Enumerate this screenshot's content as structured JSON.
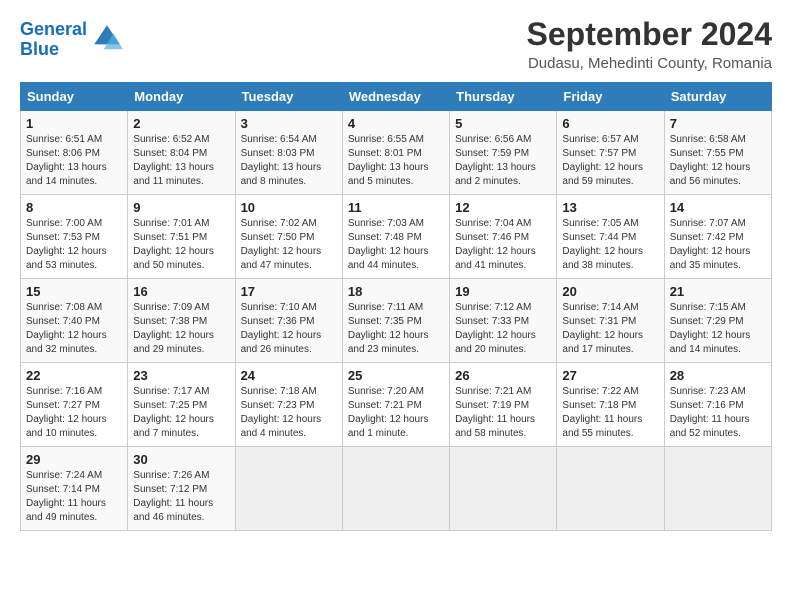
{
  "logo": {
    "line1": "General",
    "line2": "Blue"
  },
  "title": "September 2024",
  "subtitle": "Dudasu, Mehedinti County, Romania",
  "days_of_week": [
    "Sunday",
    "Monday",
    "Tuesday",
    "Wednesday",
    "Thursday",
    "Friday",
    "Saturday"
  ],
  "weeks": [
    [
      {
        "day": "1",
        "info": "Sunrise: 6:51 AM\nSunset: 8:06 PM\nDaylight: 13 hours\nand 14 minutes."
      },
      {
        "day": "2",
        "info": "Sunrise: 6:52 AM\nSunset: 8:04 PM\nDaylight: 13 hours\nand 11 minutes."
      },
      {
        "day": "3",
        "info": "Sunrise: 6:54 AM\nSunset: 8:03 PM\nDaylight: 13 hours\nand 8 minutes."
      },
      {
        "day": "4",
        "info": "Sunrise: 6:55 AM\nSunset: 8:01 PM\nDaylight: 13 hours\nand 5 minutes."
      },
      {
        "day": "5",
        "info": "Sunrise: 6:56 AM\nSunset: 7:59 PM\nDaylight: 13 hours\nand 2 minutes."
      },
      {
        "day": "6",
        "info": "Sunrise: 6:57 AM\nSunset: 7:57 PM\nDaylight: 12 hours\nand 59 minutes."
      },
      {
        "day": "7",
        "info": "Sunrise: 6:58 AM\nSunset: 7:55 PM\nDaylight: 12 hours\nand 56 minutes."
      }
    ],
    [
      {
        "day": "8",
        "info": "Sunrise: 7:00 AM\nSunset: 7:53 PM\nDaylight: 12 hours\nand 53 minutes."
      },
      {
        "day": "9",
        "info": "Sunrise: 7:01 AM\nSunset: 7:51 PM\nDaylight: 12 hours\nand 50 minutes."
      },
      {
        "day": "10",
        "info": "Sunrise: 7:02 AM\nSunset: 7:50 PM\nDaylight: 12 hours\nand 47 minutes."
      },
      {
        "day": "11",
        "info": "Sunrise: 7:03 AM\nSunset: 7:48 PM\nDaylight: 12 hours\nand 44 minutes."
      },
      {
        "day": "12",
        "info": "Sunrise: 7:04 AM\nSunset: 7:46 PM\nDaylight: 12 hours\nand 41 minutes."
      },
      {
        "day": "13",
        "info": "Sunrise: 7:05 AM\nSunset: 7:44 PM\nDaylight: 12 hours\nand 38 minutes."
      },
      {
        "day": "14",
        "info": "Sunrise: 7:07 AM\nSunset: 7:42 PM\nDaylight: 12 hours\nand 35 minutes."
      }
    ],
    [
      {
        "day": "15",
        "info": "Sunrise: 7:08 AM\nSunset: 7:40 PM\nDaylight: 12 hours\nand 32 minutes."
      },
      {
        "day": "16",
        "info": "Sunrise: 7:09 AM\nSunset: 7:38 PM\nDaylight: 12 hours\nand 29 minutes."
      },
      {
        "day": "17",
        "info": "Sunrise: 7:10 AM\nSunset: 7:36 PM\nDaylight: 12 hours\nand 26 minutes."
      },
      {
        "day": "18",
        "info": "Sunrise: 7:11 AM\nSunset: 7:35 PM\nDaylight: 12 hours\nand 23 minutes."
      },
      {
        "day": "19",
        "info": "Sunrise: 7:12 AM\nSunset: 7:33 PM\nDaylight: 12 hours\nand 20 minutes."
      },
      {
        "day": "20",
        "info": "Sunrise: 7:14 AM\nSunset: 7:31 PM\nDaylight: 12 hours\nand 17 minutes."
      },
      {
        "day": "21",
        "info": "Sunrise: 7:15 AM\nSunset: 7:29 PM\nDaylight: 12 hours\nand 14 minutes."
      }
    ],
    [
      {
        "day": "22",
        "info": "Sunrise: 7:16 AM\nSunset: 7:27 PM\nDaylight: 12 hours\nand 10 minutes."
      },
      {
        "day": "23",
        "info": "Sunrise: 7:17 AM\nSunset: 7:25 PM\nDaylight: 12 hours\nand 7 minutes."
      },
      {
        "day": "24",
        "info": "Sunrise: 7:18 AM\nSunset: 7:23 PM\nDaylight: 12 hours\nand 4 minutes."
      },
      {
        "day": "25",
        "info": "Sunrise: 7:20 AM\nSunset: 7:21 PM\nDaylight: 12 hours\nand 1 minute."
      },
      {
        "day": "26",
        "info": "Sunrise: 7:21 AM\nSunset: 7:19 PM\nDaylight: 11 hours\nand 58 minutes."
      },
      {
        "day": "27",
        "info": "Sunrise: 7:22 AM\nSunset: 7:18 PM\nDaylight: 11 hours\nand 55 minutes."
      },
      {
        "day": "28",
        "info": "Sunrise: 7:23 AM\nSunset: 7:16 PM\nDaylight: 11 hours\nand 52 minutes."
      }
    ],
    [
      {
        "day": "29",
        "info": "Sunrise: 7:24 AM\nSunset: 7:14 PM\nDaylight: 11 hours\nand 49 minutes."
      },
      {
        "day": "30",
        "info": "Sunrise: 7:26 AM\nSunset: 7:12 PM\nDaylight: 11 hours\nand 46 minutes."
      },
      {
        "day": "",
        "info": ""
      },
      {
        "day": "",
        "info": ""
      },
      {
        "day": "",
        "info": ""
      },
      {
        "day": "",
        "info": ""
      },
      {
        "day": "",
        "info": ""
      }
    ]
  ]
}
